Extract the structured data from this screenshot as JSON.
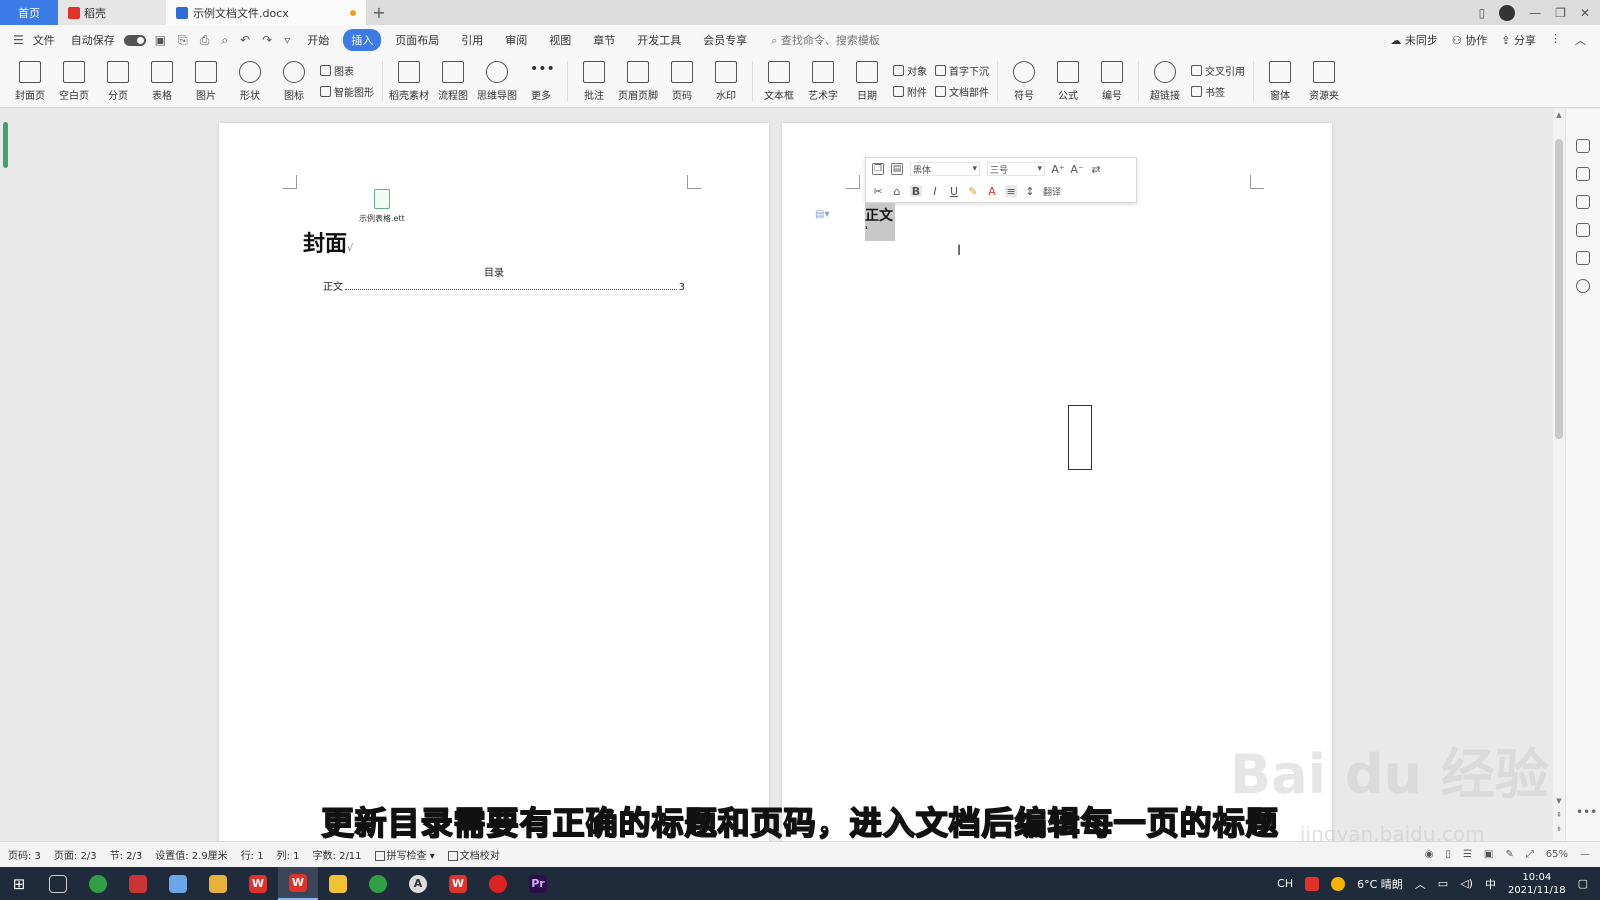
{
  "tabs": {
    "home": "首页",
    "daoke": "稻壳",
    "doc": "示例文档文件.docx",
    "add": "+"
  },
  "menu": {
    "file": "文件",
    "autosave": "自动保存",
    "items": [
      "开始",
      "插入",
      "页面布局",
      "引用",
      "审阅",
      "视图",
      "章节",
      "开发工具",
      "会员专享"
    ],
    "active": "插入",
    "search": "查找命令、搜索模板",
    "unsynced": "未同步",
    "collab": "协作",
    "share": "分享"
  },
  "ribbon": {
    "big1": [
      "封面页",
      "空白页",
      "分页",
      "表格",
      "图片",
      "形状",
      "图标"
    ],
    "small1": [
      "图表",
      "智能图形"
    ],
    "big2": [
      "稻壳素材",
      "流程图",
      "思维导图",
      "更多",
      "批注",
      "页眉页脚",
      "页码",
      "水印",
      "文本框",
      "艺术字",
      "日期"
    ],
    "small2": [
      "对象",
      "附件"
    ],
    "small3": [
      "首字下沉",
      "文档部件"
    ],
    "big3": [
      "符号",
      "公式",
      "编号",
      "超链接"
    ],
    "small4": [
      "交叉引用",
      "书签"
    ],
    "big4": [
      "窗体",
      "资源夹"
    ]
  },
  "page1": {
    "embedded_file": "示例表格.ett",
    "cover_title": "封面",
    "toc_title": "目录",
    "toc_entry": "正文",
    "toc_page": "3"
  },
  "page2": {
    "mini_toolbar": {
      "font": "黑体",
      "size": "三号",
      "translate": "翻译"
    },
    "heading": "正文"
  },
  "subtitle": "更新目录需要有正确的标题和页码，进入文档后编辑每一页的标题",
  "watermark": "Bai du 经验",
  "watermark_sub": "jingyan.baidu.com",
  "status": {
    "page_num": "页码: 3",
    "pages": "页面: 2/3",
    "section": "节: 2/3",
    "setting": "设置值: 2.9厘米",
    "row": "行: 1",
    "col": "列: 1",
    "words": "字数: 2/11",
    "spell": "拼写检查",
    "proof": "文档校对",
    "zoom": "65%"
  },
  "taskbar": {
    "input_method": "CH",
    "weather": "6°C 晴朗",
    "lang": "中",
    "time": "10:04",
    "date": "2021/11/18"
  },
  "colors": {
    "accent": "#3b7be8",
    "taskbar": "#1f2a3a",
    "wps_red": "#e0322b"
  }
}
